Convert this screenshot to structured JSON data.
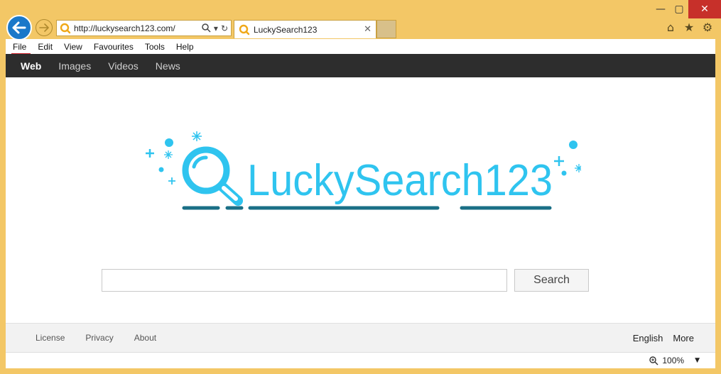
{
  "window": {
    "minimize_glyph": "—",
    "maximize_glyph": "▢",
    "close_glyph": "✕"
  },
  "address": {
    "url": "http://luckysearch123.com/"
  },
  "tab": {
    "title": "LuckySearch123",
    "close_glyph": "✕"
  },
  "menu": {
    "items": [
      "File",
      "Edit",
      "View",
      "Favourites",
      "Tools",
      "Help"
    ]
  },
  "nav": {
    "items": [
      "Web",
      "Images",
      "Videos",
      "News"
    ]
  },
  "logo": {
    "text": "LuckySearch123"
  },
  "search": {
    "value": "",
    "button_label": "Search"
  },
  "footer": {
    "left_links": [
      "License",
      "Privacy",
      "About"
    ],
    "language": "English",
    "more": "More"
  },
  "status": {
    "zoom": "100%"
  },
  "colors": {
    "chrome": "#f3c766",
    "back_button": "#1a78c9",
    "nav_bar": "#2d2d2d",
    "logo_cyan": "#2fc4ef",
    "logo_underline": "#1a6f86",
    "close_red": "#c7302a"
  },
  "icons": {
    "back": "arrow-left-icon",
    "forward": "arrow-right-icon",
    "search": "magnifier-icon",
    "refresh": "refresh-icon",
    "home": "home-icon",
    "favorites": "star-icon",
    "settings": "gear-icon",
    "zoom": "zoom-icon"
  }
}
